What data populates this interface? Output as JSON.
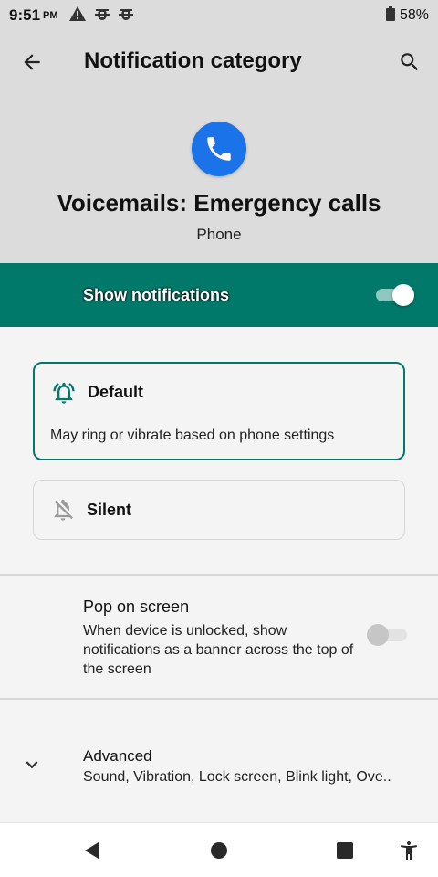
{
  "status_bar": {
    "time": "9:51",
    "ampm": "PM",
    "battery": "58%",
    "icons": [
      "warning-icon",
      "bug-icon",
      "bug-icon"
    ]
  },
  "appbar": {
    "title": "Notification category",
    "back_icon": "arrow-left-icon",
    "search_icon": "search-icon"
  },
  "channel": {
    "title": "Voicemails: Emergency calls",
    "app_name": "Phone",
    "app_icon": "phone-icon",
    "app_icon_color": "#1a73e8"
  },
  "show_notifications": {
    "label": "Show notifications",
    "enabled": true,
    "bar_color": "#00796b"
  },
  "options": {
    "default": {
      "title": "Default",
      "description": "May ring or vibrate based on phone settings",
      "selected": true,
      "icon": "bell-ringing-icon"
    },
    "silent": {
      "title": "Silent",
      "selected": false,
      "icon": "bell-off-icon"
    }
  },
  "pop_on_screen": {
    "title": "Pop on screen",
    "description": "When device is unlocked, show notifications as a banner across the top of the screen",
    "enabled": false
  },
  "advanced": {
    "title": "Advanced",
    "summary": "Sound, Vibration, Lock screen, Blink light, Ove.."
  },
  "nav_bar": {
    "buttons": [
      "back-triangle-icon",
      "home-circle-icon",
      "recents-square-icon",
      "accessibility-icon"
    ]
  }
}
